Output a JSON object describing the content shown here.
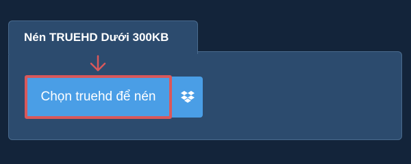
{
  "tab": {
    "title": "Nén TRUEHD Dưới 300KB"
  },
  "upload": {
    "button_label": "Chọn truehd để nén"
  },
  "icons": {
    "arrow": "arrow-down-icon",
    "dropbox": "dropbox-icon"
  },
  "colors": {
    "page_bg": "#13243a",
    "panel_bg": "#2c4b6e",
    "button_bg": "#4a9ee6",
    "highlight": "#d9585b"
  }
}
